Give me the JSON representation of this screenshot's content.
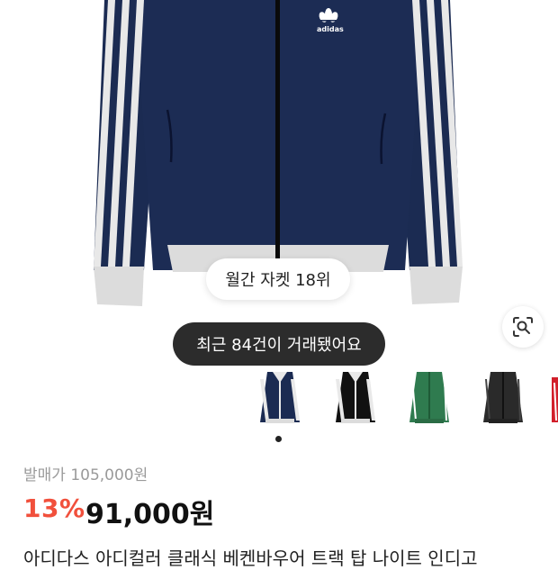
{
  "product": {
    "brand_logo_text": "adidas",
    "rank_badge": "월간 자켓 18위",
    "trade_banner": "최근 84건이 거래됐어요",
    "original_price": "발매가 105,000원",
    "discount": "13%",
    "price": "91,000원",
    "title": "아디다스 아디컬러 클래식 베켄바우어 트랙 탑 나이트 인디고"
  },
  "thumbnails": [
    {
      "name": "navy",
      "body": "#1b2b52",
      "stripe": "#e9e9e9",
      "selected": true
    },
    {
      "name": "black",
      "body": "#111111",
      "stripe": "#e9e9e9",
      "selected": false
    },
    {
      "name": "green",
      "body": "#2f7b4f",
      "stripe": "#ffffff",
      "selected": false
    },
    {
      "name": "charcoal",
      "body": "#2a2a2a",
      "stripe": "#444444",
      "selected": false
    },
    {
      "name": "red",
      "body": "#d21f2b",
      "stripe": "#ffffff",
      "selected": false
    }
  ],
  "icons": {
    "lens": "lens-search-icon",
    "logo": "trefoil-logo-icon"
  },
  "colors": {
    "discount": "#f1503c",
    "jacket_navy": "#1b2b52"
  }
}
